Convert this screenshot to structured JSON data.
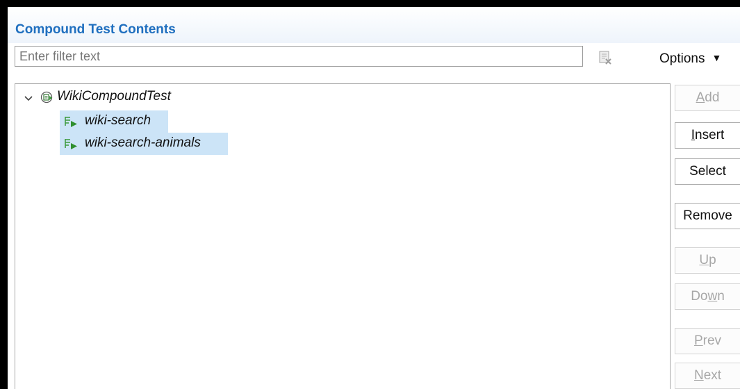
{
  "panel": {
    "title": "Compound Test Contents"
  },
  "filter": {
    "placeholder": "Enter filter text",
    "value": ""
  },
  "toolbar": {
    "options_label": "Options"
  },
  "tree": {
    "root": {
      "label": "WikiCompoundTest",
      "expanded": true
    },
    "children": [
      {
        "label": "wiki-search",
        "selected": true
      },
      {
        "label": "wiki-search-animals",
        "selected": true
      }
    ]
  },
  "buttons": {
    "add": {
      "mn": "A",
      "rest": "dd",
      "disabled": true
    },
    "insert": {
      "mn": "I",
      "rest": "nsert",
      "disabled": false
    },
    "select": {
      "label": "Select",
      "disabled": false
    },
    "remove": {
      "label": "Remove",
      "disabled": false
    },
    "up": {
      "mn": "U",
      "rest": "p",
      "disabled": true
    },
    "down": {
      "pre": "Do",
      "mn": "w",
      "rest": "n",
      "disabled": true
    },
    "prev": {
      "mn": "P",
      "rest": "rev",
      "disabled": true
    },
    "next": {
      "mn": "N",
      "rest": "ext",
      "disabled": true
    }
  },
  "colors": {
    "title": "#1f6fbf",
    "selection": "#cce4f7",
    "disabled_text": "#a7a7a7",
    "test_icon_green": "#3a9a3a"
  }
}
